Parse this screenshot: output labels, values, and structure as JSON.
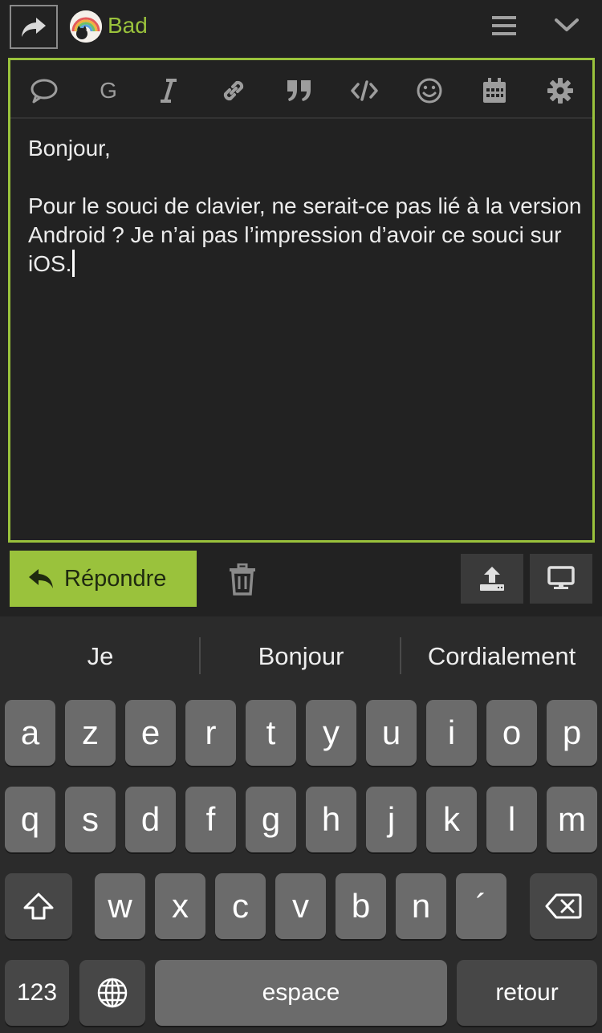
{
  "header": {
    "username": "Bad",
    "icons": [
      "share-icon",
      "avatar",
      "hamburger-icon",
      "chevron-down-icon"
    ]
  },
  "toolbar": {
    "g_label": "G",
    "icons": [
      "speech-bubble-icon",
      "bold-g",
      "italic-icon",
      "link-icon",
      "quote-icon",
      "code-icon",
      "emoji-icon",
      "calendar-icon",
      "gear-icon"
    ]
  },
  "editor": {
    "text": "Bonjour,\n\nPour le souci de clavier, ne serait-ce pas lié à la version Android ? Je n’ai pas l’impression d’avoir ce souci sur iOS."
  },
  "actions": {
    "reply_label": "Répondre"
  },
  "keyboard": {
    "suggestions": [
      "Je",
      "Bonjour",
      "Cordialement"
    ],
    "row1": [
      "a",
      "z",
      "e",
      "r",
      "t",
      "y",
      "u",
      "i",
      "o",
      "p"
    ],
    "row2": [
      "q",
      "s",
      "d",
      "f",
      "g",
      "h",
      "j",
      "k",
      "l",
      "m"
    ],
    "row3": [
      "w",
      "x",
      "c",
      "v",
      "b",
      "n",
      "´"
    ],
    "numbers_label": "123",
    "space_label": "espace",
    "return_label": "retour"
  },
  "colors": {
    "accent": "#9ac23c",
    "background": "#222222",
    "key": "#6b6b6b",
    "key_dark": "#474747"
  }
}
